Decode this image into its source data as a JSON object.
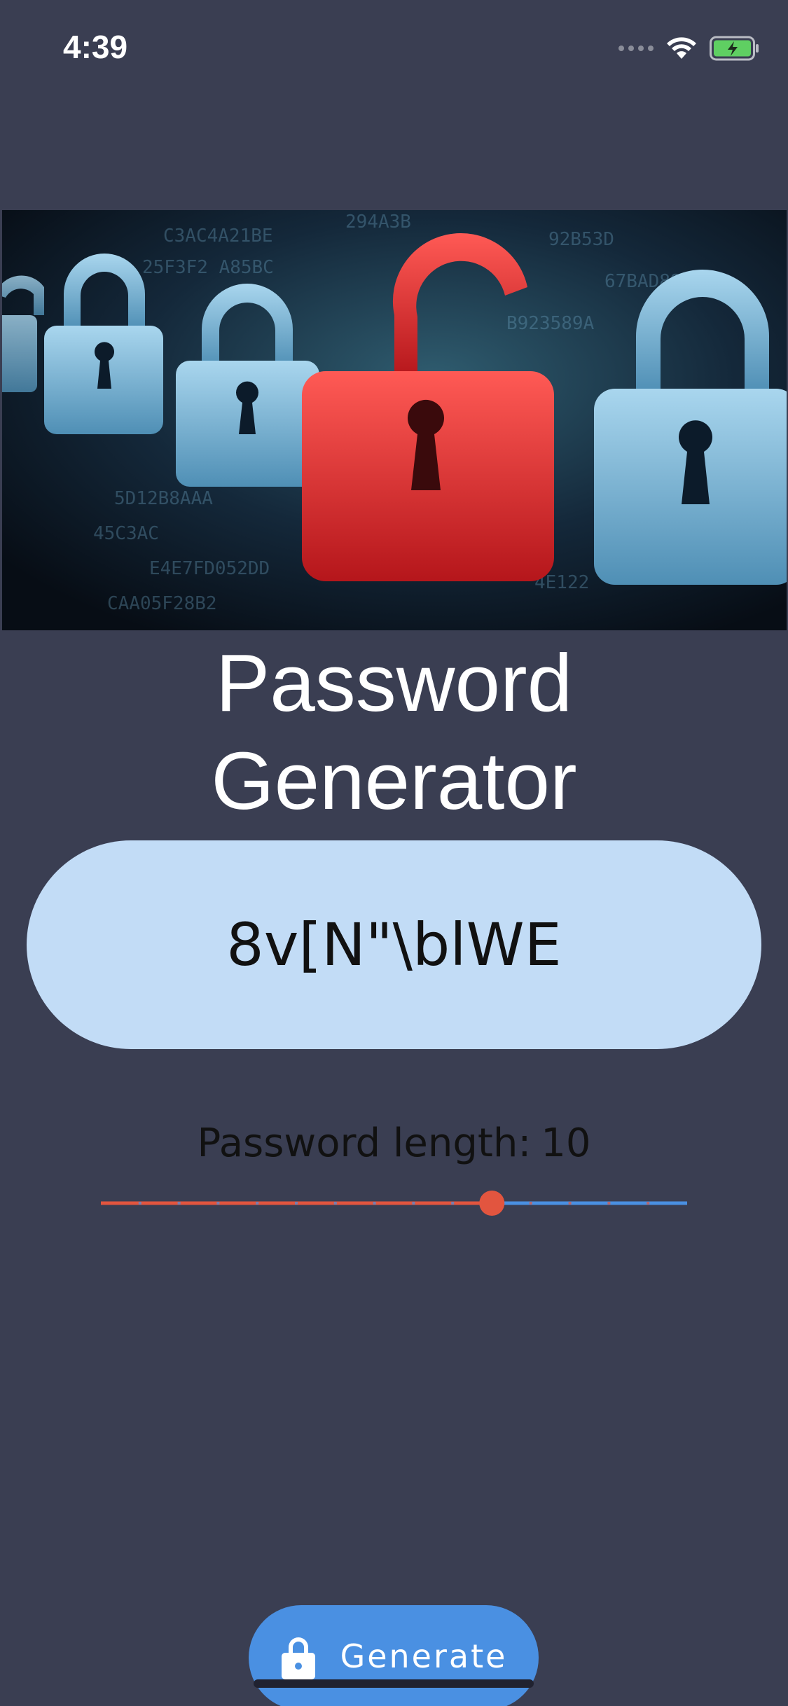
{
  "status_bar": {
    "time": "4:39"
  },
  "hero": {
    "icon": "padlocks-image"
  },
  "title": {
    "line1": "Password",
    "line2": "Generator"
  },
  "password": {
    "value": "8v[N\"\\blWE"
  },
  "length": {
    "label": "Password length:",
    "value": "10",
    "slider_fraction": 0.667
  },
  "generate_button": {
    "label": "Generate",
    "icon": "lock-icon"
  },
  "colors": {
    "background": "#3a3e52",
    "pill": "#c2dcf6",
    "slider_active": "#e2553f",
    "slider_inactive": "#4a90e2",
    "button": "#4a90e2"
  }
}
